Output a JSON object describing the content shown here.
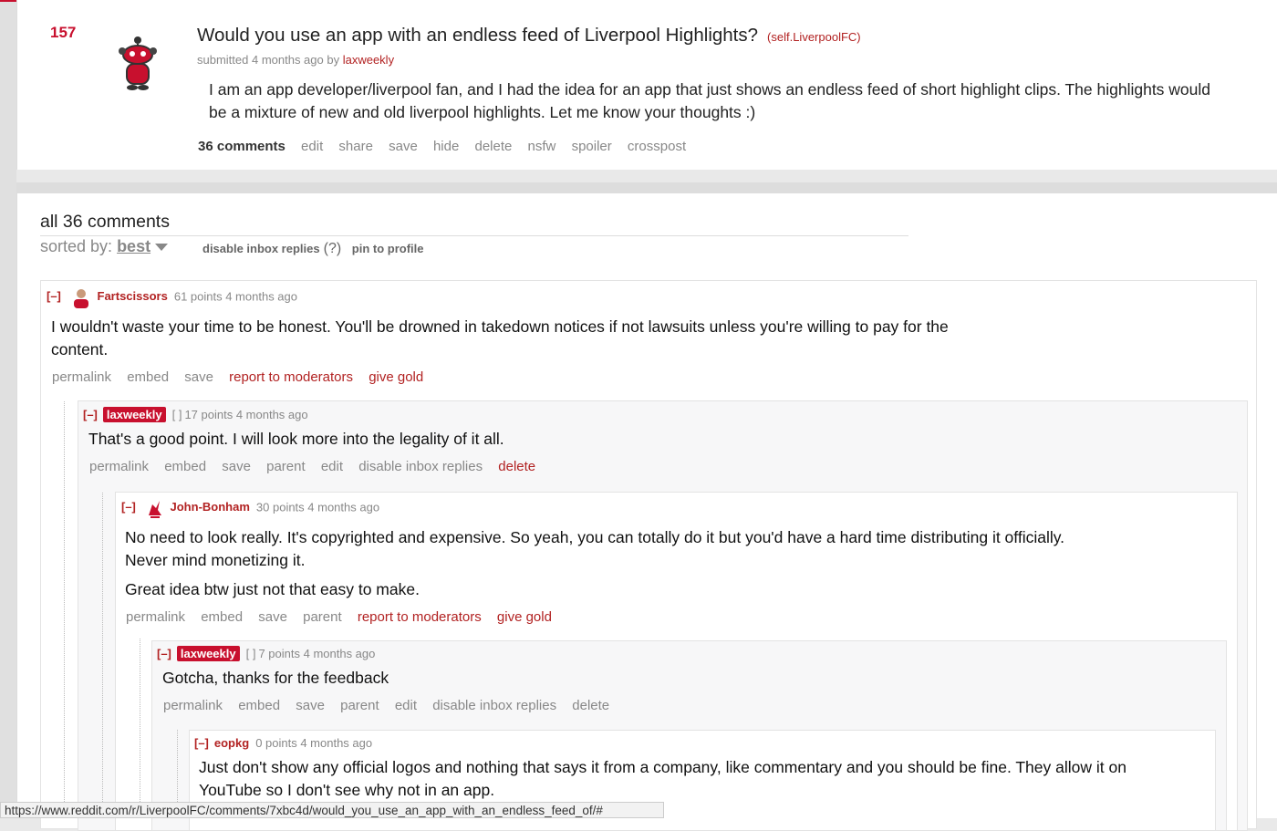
{
  "post": {
    "score": "157",
    "title": "Would you use an app with an endless feed of Liverpool Highlights?",
    "domain": "(self.LiverpoolFC)",
    "tagline_prefix": "submitted 4 months ago by",
    "author": "laxweekly",
    "selftext": "I am an app developer/liverpool fan, and I had the idea for an app that just shows an endless feed of short highlight clips. The highlights would be a mixture of new and old liverpool highlights. Let me know your thoughts :)",
    "buttons": {
      "comments": "36 comments",
      "edit": "edit",
      "share": "share",
      "save": "save",
      "hide": "hide",
      "delete": "delete",
      "nsfw": "nsfw",
      "spoiler": "spoiler",
      "crosspost": "crosspost"
    }
  },
  "comments_header": {
    "title": "all 36 comments",
    "sorted_label": "sorted by:",
    "sorted_value": "best",
    "disable_inbox": "disable inbox replies",
    "help": "(?)",
    "pin": "pin to profile"
  },
  "comments": [
    {
      "expand": "[–]",
      "author": "Fartscissors",
      "meta": "61 points 4 months ago",
      "lines": [
        "I wouldn't waste your time to be honest. You'll be drowned in takedown notices if not lawsuits unless you're willing to pay for the",
        "content."
      ],
      "buttons": {
        "permalink": "permalink",
        "embed": "embed",
        "save": "save",
        "report": "report to moderators",
        "gold": "give gold"
      }
    },
    {
      "expand": "[–]",
      "author": "laxweekly",
      "flair": "[    ]",
      "meta": "17 points 4 months ago",
      "lines": [
        "That's a good point. I will look more into the legality of it all."
      ],
      "buttons": {
        "permalink": "permalink",
        "embed": "embed",
        "save": "save",
        "parent": "parent",
        "edit": "edit",
        "disable": "disable inbox replies",
        "delete": "delete"
      }
    },
    {
      "expand": "[–]",
      "author": "John-Bonham",
      "meta": "30 points 4 months ago",
      "lines": [
        "No need to look really. It's copyrighted and expensive. So yeah, you can totally do it but you'd have a hard time distributing it officially.",
        "Never mind monetizing it."
      ],
      "line2": "Great idea btw just not that easy to make.",
      "buttons": {
        "permalink": "permalink",
        "embed": "embed",
        "save": "save",
        "parent": "parent",
        "report": "report to moderators",
        "gold": "give gold"
      }
    },
    {
      "expand": "[–]",
      "author": "laxweekly",
      "flair": "[    ]",
      "meta": "7 points 4 months ago",
      "lines": [
        "Gotcha, thanks for the feedback"
      ],
      "buttons": {
        "permalink": "permalink",
        "embed": "embed",
        "save": "save",
        "parent": "parent",
        "edit": "edit",
        "disable": "disable inbox replies",
        "delete": "delete"
      }
    },
    {
      "expand": "[–]",
      "author": "eopkg",
      "meta": "0 points 4 months ago",
      "lines": [
        "Just don't show any official logos and nothing that says it from a company, like commentary and you should be fine. They allow it on",
        "YouTube so I don't see why not in an app."
      ]
    }
  ],
  "status_url": "https://www.reddit.com/r/LiverpoolFC/comments/7xbc4d/would_you_use_an_app_with_an_endless_feed_of/#",
  "colors": {
    "accent": "#c8102e",
    "link_red": "#b22222",
    "muted": "#888888"
  }
}
